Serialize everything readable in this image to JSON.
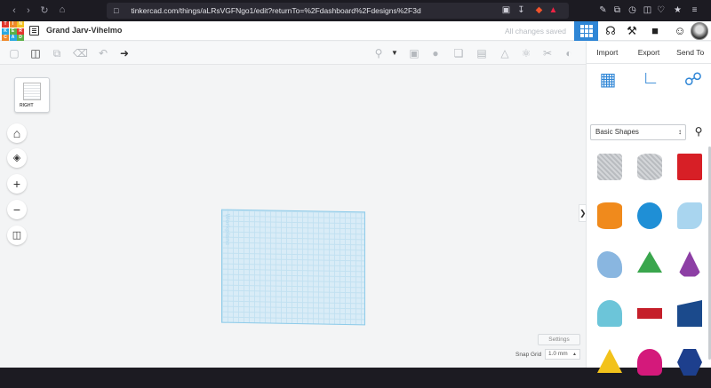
{
  "browser": {
    "url": "tinkercad.com/things/aLRsVGFNgo1/edit?returnTo=%2Fdashboard%2Fdesigns%2F3d"
  },
  "header": {
    "logo_letters": [
      "T",
      "I",
      "N",
      "K",
      "E",
      "R",
      "C",
      "A",
      "D"
    ],
    "logo_colors": [
      "#e2372d",
      "#f0892b",
      "#f3c221",
      "#29a8e1",
      "#5bb148",
      "#e2372d",
      "#f0892b",
      "#29a8e1",
      "#5bb148"
    ],
    "design_name": "Grand Jarv-Vihelmo",
    "save_status": "All changes saved"
  },
  "right_panel": {
    "tabs": [
      "Import",
      "Export",
      "Send To"
    ],
    "shape_category": "Basic Shapes"
  },
  "shapes": [
    {
      "name": "box-hole",
      "color": "#b9bcc0"
    },
    {
      "name": "cylinder-hole",
      "color": "#b9bcc0"
    },
    {
      "name": "box",
      "color": "#d71f26"
    },
    {
      "name": "cylinder",
      "color": "#f08a1c"
    },
    {
      "name": "sphere",
      "color": "#1f8fd6"
    },
    {
      "name": "scribble",
      "color": "#a9d5ef"
    },
    {
      "name": "shape-generator",
      "color": "#89b6e0"
    },
    {
      "name": "pyramid",
      "color": "#3aa64d"
    },
    {
      "name": "cone",
      "color": "#8d3fa5"
    },
    {
      "name": "roof",
      "color": "#6cc5d9"
    },
    {
      "name": "text",
      "color": "#c51f2a"
    },
    {
      "name": "wedge",
      "color": "#1b4a8c"
    },
    {
      "name": "pyramid-yellow",
      "color": "#f2c21b"
    },
    {
      "name": "half-sphere",
      "color": "#d4197b"
    },
    {
      "name": "polygon",
      "color": "#1d3f8d"
    }
  ],
  "canvas": {
    "workplane_label": "Workplane",
    "viewcube_label": "RIGHT"
  },
  "footer": {
    "settings_label": "Settings",
    "snap_grid_label": "Snap Grid",
    "snap_grid_value": "1.0 mm"
  }
}
